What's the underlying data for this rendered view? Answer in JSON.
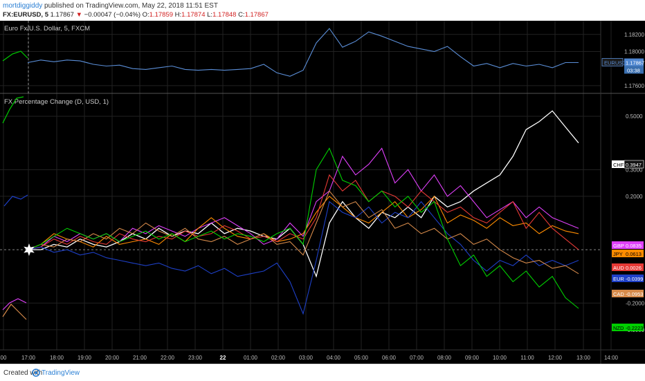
{
  "header": {
    "user": "mortdiggiddy",
    "published": " published on TradingView.com, May 22, 2018 11:51 EST",
    "symbol": "FX:EURUSD, 5",
    "last": "1.17867",
    "change": "−0.00047 (−0.04%)",
    "o_label": "O:",
    "open": "1.17859",
    "h_label": "H:",
    "high": "1.17874",
    "l_label": "L:",
    "low": "1.17848",
    "c_label": "C:",
    "close": "1.17867"
  },
  "top_pane": {
    "title": "Euro Fx/U.S. Dollar, 5, FXCM"
  },
  "bottom_pane": {
    "title": "FX Percentage Change (D, USD, 1)"
  },
  "footer": {
    "created": "Created with",
    "brand": "TradingView"
  },
  "colors": {
    "background": "#000000",
    "grid": "#222222",
    "axis_text": "#bbbbbb",
    "eurusd": "#5b8fd9",
    "chf": "#ffffff",
    "gbp": "#e040fb",
    "jpy": "#ff8c00",
    "aud": "#e53935",
    "eur": "#1e40c8",
    "cad": "#d68a4a",
    "nzd": "#00d000"
  },
  "chart_data": [
    {
      "type": "line",
      "title": "Euro Fx/U.S. Dollar, 5, FXCM",
      "yticks": [
        "1.18200",
        "1.18000",
        "1.17600"
      ],
      "ylim": [
        1.1755,
        1.1832
      ],
      "series": [
        {
          "name": "EURUSD",
          "label": "EURUSD",
          "last_label": "1.17867",
          "countdown": "03:38",
          "color": "#5b8fd9",
          "x": [
            0,
            0.5,
            1,
            1.5,
            2,
            2.5,
            3,
            3.5,
            4,
            4.5,
            5,
            5.5,
            6,
            6.5,
            7,
            7.5,
            8,
            8.5,
            9,
            9.5,
            10,
            10.5,
            11,
            11.5,
            12,
            12.5,
            13,
            13.5,
            14,
            14.5,
            15,
            15.5,
            16,
            16.5,
            17,
            17.5,
            18,
            18.5,
            19,
            19.5,
            20,
            20.5,
            21
          ],
          "y": [
            1.1787,
            1.179,
            1.1788,
            1.179,
            1.1789,
            1.1785,
            1.1783,
            1.1784,
            1.178,
            1.1779,
            1.1781,
            1.1783,
            1.1779,
            1.1778,
            1.1779,
            1.1778,
            1.1779,
            1.178,
            1.1785,
            1.1775,
            1.1771,
            1.1778,
            1.181,
            1.1827,
            1.1805,
            1.1812,
            1.1823,
            1.1818,
            1.1812,
            1.1806,
            1.1803,
            1.18,
            1.1806,
            1.1794,
            1.1783,
            1.1786,
            1.1781,
            1.1786,
            1.1783,
            1.1785,
            1.1781,
            1.1787,
            1.1787
          ]
        }
      ]
    },
    {
      "type": "line",
      "title": "FX Percentage Change (D, USD, 1)",
      "x_ticks": [
        "00",
        "17:00",
        "18:00",
        "19:00",
        "20:00",
        "21:00",
        "22:00",
        "23:00",
        "22",
        "01:00",
        "02:00",
        "03:00",
        "04:00",
        "05:00",
        "06:00",
        "07:00",
        "08:00",
        "09:00",
        "10:00",
        "11:00",
        "12:00",
        "13:00",
        "14:00"
      ],
      "yticks": [
        "0.5000",
        "0.3000",
        "0.2000",
        "-0.2000",
        "-0.3000"
      ],
      "ylim": [
        -0.36,
        0.56
      ],
      "series": [
        {
          "name": "CHF",
          "value_label": "0.3947",
          "color": "#ffffff",
          "x": [
            0,
            0.5,
            1,
            1.5,
            2,
            2.5,
            3,
            3.5,
            4,
            4.5,
            5,
            5.5,
            6,
            6.5,
            7,
            7.5,
            8,
            8.5,
            9,
            9.5,
            10,
            10.5,
            11,
            11.5,
            12,
            12.5,
            13,
            13.5,
            14,
            14.5,
            15,
            15.5,
            16,
            16.5,
            17,
            17.5,
            18,
            18.5,
            19,
            19.5,
            20,
            20.5,
            21
          ],
          "y": [
            0.0,
            0.0,
            0.02,
            0.01,
            0.04,
            0.02,
            0.01,
            0.03,
            0.06,
            0.04,
            0.08,
            0.05,
            0.07,
            0.06,
            0.1,
            0.06,
            0.08,
            0.07,
            0.05,
            0.04,
            0.08,
            0.02,
            -0.1,
            0.1,
            0.18,
            0.12,
            0.08,
            0.14,
            0.12,
            0.16,
            0.12,
            0.2,
            0.16,
            0.18,
            0.22,
            0.25,
            0.28,
            0.35,
            0.45,
            0.48,
            0.52,
            0.46,
            0.4
          ]
        },
        {
          "name": "GBP",
          "value_label": "0.0835",
          "color": "#e040fb",
          "x": [
            0,
            0.5,
            1,
            1.5,
            2,
            2.5,
            3,
            3.5,
            4,
            4.5,
            5,
            5.5,
            6,
            6.5,
            7,
            7.5,
            8,
            8.5,
            9,
            9.5,
            10,
            10.5,
            11,
            11.5,
            12,
            12.5,
            13,
            13.5,
            14,
            14.5,
            15,
            15.5,
            16,
            16.5,
            17,
            17.5,
            18,
            18.5,
            19,
            19.5,
            20,
            20.5,
            21
          ],
          "y": [
            0.0,
            0.01,
            0.05,
            0.03,
            0.06,
            0.04,
            0.06,
            0.03,
            0.08,
            0.06,
            0.09,
            0.07,
            0.05,
            0.08,
            0.1,
            0.12,
            0.09,
            0.06,
            0.02,
            0.04,
            0.1,
            0.05,
            0.18,
            0.22,
            0.35,
            0.28,
            0.32,
            0.38,
            0.25,
            0.3,
            0.22,
            0.28,
            0.2,
            0.24,
            0.18,
            0.12,
            0.15,
            0.18,
            0.12,
            0.16,
            0.12,
            0.1,
            0.08
          ]
        },
        {
          "name": "JPY",
          "value_label": "0.0613",
          "color": "#ff8c00",
          "x": [
            0,
            0.5,
            1,
            1.5,
            2,
            2.5,
            3,
            3.5,
            4,
            4.5,
            5,
            5.5,
            6,
            6.5,
            7,
            7.5,
            8,
            8.5,
            9,
            9.5,
            10,
            10.5,
            11,
            11.5,
            12,
            12.5,
            13,
            13.5,
            14,
            14.5,
            15,
            15.5,
            16,
            16.5,
            17,
            17.5,
            18,
            18.5,
            19,
            19.5,
            20,
            20.5,
            21
          ],
          "y": [
            0.0,
            0.02,
            0.06,
            0.04,
            0.03,
            0.01,
            0.05,
            0.02,
            0.03,
            0.04,
            0.02,
            0.06,
            0.03,
            0.08,
            0.12,
            0.08,
            0.05,
            0.04,
            0.06,
            0.03,
            0.04,
            0.06,
            0.14,
            0.2,
            0.16,
            0.12,
            0.1,
            0.14,
            0.18,
            0.12,
            0.15,
            0.2,
            0.1,
            0.13,
            0.11,
            0.08,
            0.12,
            0.09,
            0.1,
            0.06,
            0.09,
            0.07,
            0.06
          ]
        },
        {
          "name": "AUD",
          "value_label": "0.0026",
          "color": "#e53935",
          "x": [
            0,
            0.5,
            1,
            1.5,
            2,
            2.5,
            3,
            3.5,
            4,
            4.5,
            5,
            5.5,
            6,
            6.5,
            7,
            7.5,
            8,
            8.5,
            9,
            9.5,
            10,
            10.5,
            11,
            11.5,
            12,
            12.5,
            13,
            13.5,
            14,
            14.5,
            15,
            15.5,
            16,
            16.5,
            17,
            17.5,
            18,
            18.5,
            19,
            19.5,
            20,
            20.5,
            21
          ],
          "y": [
            0.0,
            0.01,
            0.04,
            0.02,
            0.05,
            0.03,
            0.02,
            0.06,
            0.04,
            0.03,
            0.05,
            0.04,
            0.07,
            0.05,
            0.06,
            0.09,
            0.07,
            0.04,
            0.05,
            0.03,
            0.06,
            0.04,
            0.12,
            0.28,
            0.22,
            0.26,
            0.18,
            0.22,
            0.2,
            0.16,
            0.22,
            0.18,
            0.14,
            0.16,
            0.12,
            0.1,
            0.14,
            0.18,
            0.08,
            0.14,
            0.08,
            0.04,
            0.0
          ]
        },
        {
          "name": "EUR",
          "value_label": "-0.0399",
          "color": "#1e40c8",
          "x": [
            0,
            0.5,
            1,
            1.5,
            2,
            2.5,
            3,
            3.5,
            4,
            4.5,
            5,
            5.5,
            6,
            6.5,
            7,
            7.5,
            8,
            8.5,
            9,
            9.5,
            10,
            10.5,
            11,
            11.5,
            12,
            12.5,
            13,
            13.5,
            14,
            14.5,
            15,
            15.5,
            16,
            16.5,
            17,
            17.5,
            18,
            18.5,
            19,
            19.5,
            20,
            20.5,
            21
          ],
          "y": [
            0.0,
            0.01,
            -0.01,
            0.0,
            -0.02,
            -0.01,
            -0.03,
            -0.04,
            -0.05,
            -0.06,
            -0.05,
            -0.07,
            -0.08,
            -0.06,
            -0.09,
            -0.07,
            -0.1,
            -0.09,
            -0.08,
            -0.05,
            -0.12,
            -0.24,
            -0.04,
            0.18,
            0.14,
            0.12,
            0.16,
            0.1,
            0.14,
            0.12,
            0.18,
            0.12,
            0.06,
            0.02,
            -0.04,
            -0.08,
            -0.04,
            -0.06,
            -0.02,
            -0.06,
            -0.04,
            -0.06,
            -0.04
          ]
        },
        {
          "name": "CAD",
          "value_label": "-0.0953",
          "color": "#d68a4a",
          "x": [
            0,
            0.5,
            1,
            1.5,
            2,
            2.5,
            3,
            3.5,
            4,
            4.5,
            5,
            5.5,
            6,
            6.5,
            7,
            7.5,
            8,
            8.5,
            9,
            9.5,
            10,
            10.5,
            11,
            11.5,
            12,
            12.5,
            13,
            13.5,
            14,
            14.5,
            15,
            15.5,
            16,
            16.5,
            17,
            17.5,
            18,
            18.5,
            19,
            19.5,
            20,
            20.5,
            21
          ],
          "y": [
            0.0,
            0.02,
            0.01,
            0.04,
            0.03,
            0.06,
            0.04,
            0.08,
            0.06,
            0.1,
            0.07,
            0.05,
            0.08,
            0.04,
            0.03,
            0.05,
            0.02,
            0.04,
            0.06,
            0.02,
            0.03,
            -0.02,
            0.1,
            0.22,
            0.16,
            0.18,
            0.12,
            0.15,
            0.08,
            0.1,
            0.06,
            0.08,
            0.04,
            0.06,
            0.02,
            0.04,
            0.0,
            -0.03,
            -0.05,
            -0.04,
            -0.07,
            -0.06,
            -0.09
          ]
        },
        {
          "name": "NZD",
          "value_label": "-0.2223",
          "color": "#00d000",
          "x": [
            0,
            0.5,
            1,
            1.5,
            2,
            2.5,
            3,
            3.5,
            4,
            4.5,
            5,
            5.5,
            6,
            6.5,
            7,
            7.5,
            8,
            8.5,
            9,
            9.5,
            10,
            10.5,
            11,
            11.5,
            12,
            12.5,
            13,
            13.5,
            14,
            14.5,
            15,
            15.5,
            16,
            16.5,
            17,
            17.5,
            18,
            18.5,
            19,
            19.5,
            20,
            20.5,
            21
          ],
          "y": [
            0.0,
            0.02,
            0.05,
            0.08,
            0.06,
            0.04,
            0.06,
            0.03,
            0.05,
            0.07,
            0.04,
            0.06,
            0.03,
            0.05,
            0.07,
            0.04,
            0.06,
            0.05,
            0.03,
            0.06,
            0.08,
            0.02,
            0.3,
            0.38,
            0.26,
            0.24,
            0.18,
            0.22,
            0.16,
            0.2,
            0.14,
            0.18,
            0.04,
            -0.06,
            -0.02,
            -0.1,
            -0.06,
            -0.12,
            -0.08,
            -0.14,
            -0.1,
            -0.18,
            -0.22
          ]
        }
      ]
    }
  ]
}
